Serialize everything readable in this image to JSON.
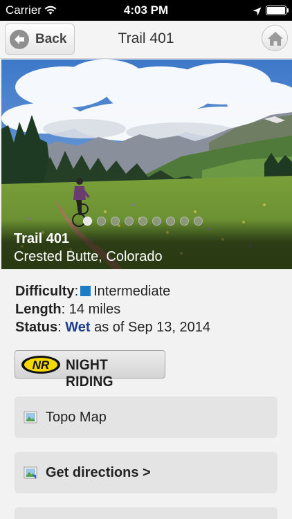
{
  "status_bar": {
    "carrier": "Carrier",
    "time": "4:03 PM"
  },
  "nav": {
    "back_label": "Back",
    "title": "Trail 401"
  },
  "hero": {
    "trail_name": "Trail 401",
    "location": "Crested Butte, Colorado",
    "photo_count": 9,
    "active_photo": 1
  },
  "details": {
    "difficulty_label": "Difficulty",
    "difficulty_value": "Intermediate",
    "difficulty_color": "#1a7dc6",
    "length_label": "Length",
    "length_value": "14 miles",
    "status_label": "Status",
    "status_value": "Wet",
    "status_date": "as of Sep 13, 2014",
    "status_color": "#1f3f8c"
  },
  "badge": {
    "logo_text": "NR",
    "label": "NIGHT RIDING"
  },
  "actions": [
    {
      "label": "Topo Map",
      "icon": "map-image-icon",
      "bold": false
    },
    {
      "label": "Get directions >",
      "icon": "directions-image-icon",
      "bold": true
    }
  ]
}
